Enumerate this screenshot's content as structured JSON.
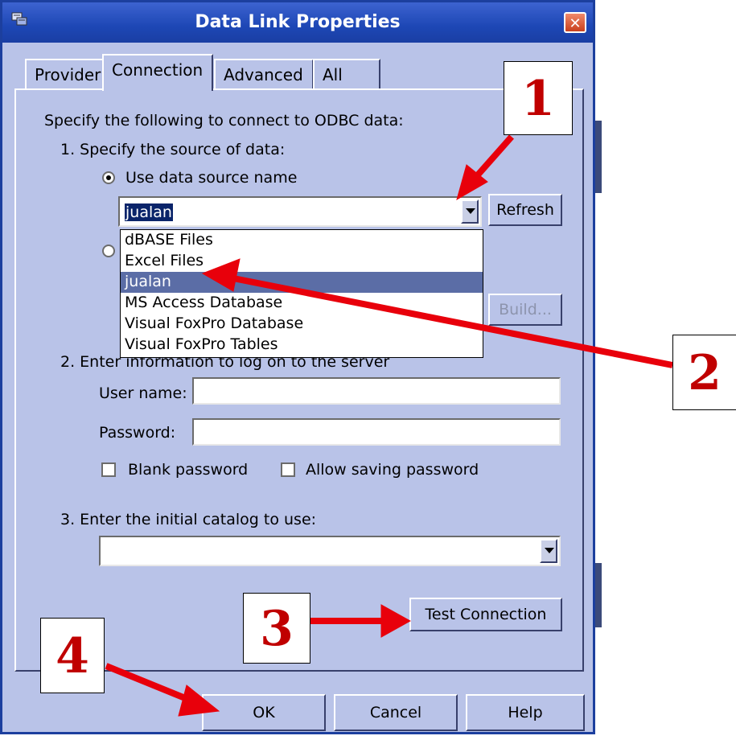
{
  "window": {
    "title": "Data Link Properties"
  },
  "tabs": [
    {
      "label": "Provider",
      "active": false
    },
    {
      "label": "Connection",
      "active": true
    },
    {
      "label": "Advanced",
      "active": false
    },
    {
      "label": "All",
      "active": false
    }
  ],
  "connection": {
    "intro": "Specify the following to connect to ODBC data:",
    "step1": "1. Specify the source of data:",
    "use_dsn_label": "Use data source name",
    "dsn_value": "jualan",
    "refresh_label": "Refresh",
    "build_label": "Build...",
    "dsn_options": [
      "dBASE Files",
      "Excel Files",
      "jualan",
      "MS Access Database",
      "Visual FoxPro Database",
      "Visual FoxPro Tables"
    ],
    "dsn_selected_index": 2,
    "step2": "2. Enter information to log on to the server",
    "username_label": "User name:",
    "username_value": "",
    "password_label": "Password:",
    "password_value": "",
    "blank_password_label": "Blank password",
    "allow_saving_label": "Allow saving password",
    "step3": "3. Enter the initial catalog to use:",
    "catalog_value": "",
    "test_connection_label": "Test Connection"
  },
  "buttons": {
    "ok": "OK",
    "cancel": "Cancel",
    "help": "Help"
  },
  "annotations": {
    "n1": "1",
    "n2": "2",
    "n3": "3",
    "n4": "4",
    "arrow_color": "#e8000b"
  }
}
